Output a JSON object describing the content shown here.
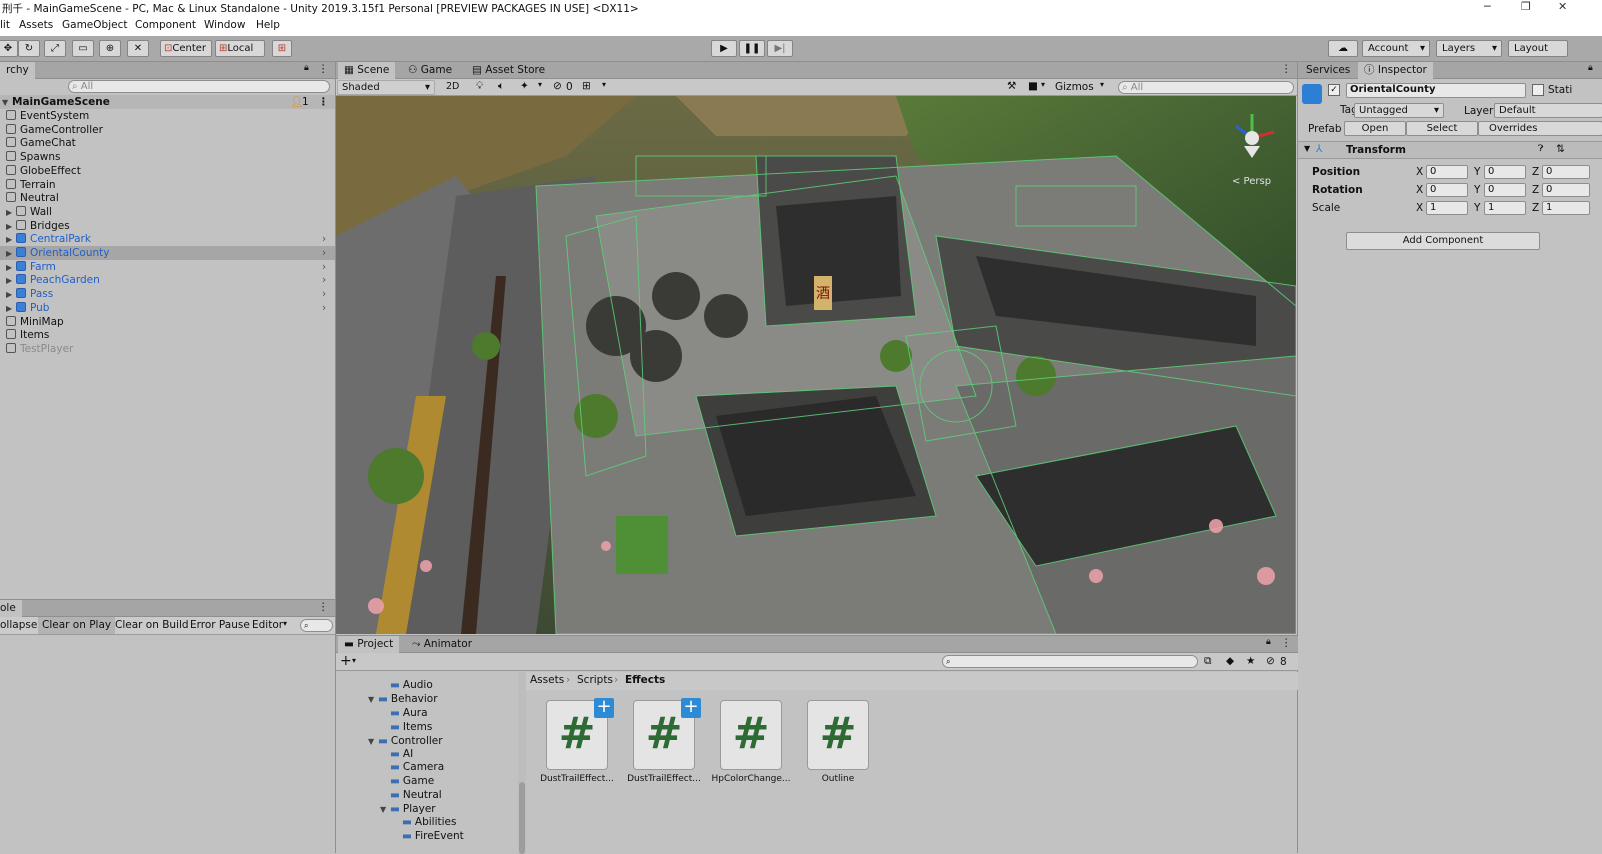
{
  "window": {
    "title": "刑千 - MainGameScene - PC, Mac & Linux Standalone - Unity 2019.3.15f1 Personal [PREVIEW PACKAGES IN USE] <DX11>",
    "minimize": "─",
    "restore": "❐",
    "close": "✕"
  },
  "menu": [
    "lit",
    "Assets",
    "GameObject",
    "Component",
    "Window",
    "Help"
  ],
  "toolbar": {
    "center": "Center",
    "local": "Local",
    "account": "Account",
    "layers": "Layers",
    "layout": "Layout"
  },
  "hierarchy": {
    "tab": "rchy",
    "search_placeholder": "All",
    "scene": "MainGameScene",
    "badge": "1",
    "items": [
      {
        "label": "EventSystem",
        "prefab": false
      },
      {
        "label": "GameController",
        "prefab": false
      },
      {
        "label": "GameChat",
        "prefab": false
      },
      {
        "label": "Spawns",
        "prefab": false
      },
      {
        "label": "GlobeEffect",
        "prefab": false
      },
      {
        "label": "Terrain",
        "prefab": false
      },
      {
        "label": "Neutral",
        "prefab": false
      },
      {
        "label": "Wall",
        "prefab": false
      },
      {
        "label": "Bridges",
        "prefab": false
      },
      {
        "label": "CentralPark",
        "prefab": true
      },
      {
        "label": "OrientalCounty",
        "prefab": true
      },
      {
        "label": "Farm",
        "prefab": true
      },
      {
        "label": "PeachGarden",
        "prefab": true
      },
      {
        "label": "Pass",
        "prefab": true
      },
      {
        "label": "Pub",
        "prefab": true
      },
      {
        "label": "MiniMap",
        "prefab": false
      },
      {
        "label": "Items",
        "prefab": false
      },
      {
        "label": "TestPlayer",
        "prefab": false
      }
    ]
  },
  "console": {
    "tab": "ole",
    "buttons": [
      "ollapse",
      "Clear on Play",
      "Clear on Build",
      "Error Pause",
      "Editor"
    ]
  },
  "scene_view": {
    "tabs": [
      "Scene",
      "Game",
      "Asset Store"
    ],
    "shading": "Shaded",
    "mode_2d": "2D",
    "hidden_count": "0",
    "gizmos": "Gizmos",
    "search_placeholder": "All",
    "persp": "< Persp",
    "sign": "酒"
  },
  "inspector": {
    "tabs": [
      "Services",
      "Inspector"
    ],
    "object_name": "OrientalCounty",
    "static": "Stati",
    "tag_label": "Tag",
    "tag_value": "Untagged",
    "layer_label": "Layer",
    "layer_value": "Default",
    "prefab_label": "Prefab",
    "prefab_open": "Open",
    "prefab_select": "Select",
    "prefab_overrides": "Overrides",
    "component": "Transform",
    "position_label": "Position",
    "rotation_label": "Rotation",
    "scale_label": "Scale",
    "position": [
      "0",
      "0",
      "0"
    ],
    "rotation": [
      "0",
      "0",
      "0"
    ],
    "scale": [
      "1",
      "1",
      "1"
    ],
    "axes": [
      "X",
      "Y",
      "Z"
    ],
    "add_component": "Add Component"
  },
  "project": {
    "tabs": [
      "Project",
      "Animator"
    ],
    "hidden_count": "8",
    "folders": [
      {
        "label": "Audio",
        "depth": 2
      },
      {
        "label": "Behavior",
        "depth": 1
      },
      {
        "label": "Aura",
        "depth": 2
      },
      {
        "label": "Items",
        "depth": 2
      },
      {
        "label": "Controller",
        "depth": 1
      },
      {
        "label": "AI",
        "depth": 2
      },
      {
        "label": "Camera",
        "depth": 2
      },
      {
        "label": "Game",
        "depth": 2
      },
      {
        "label": "Neutral",
        "depth": 2
      },
      {
        "label": "Player",
        "depth": 2
      },
      {
        "label": "Abilities",
        "depth": 3
      },
      {
        "label": "FireEvent",
        "depth": 3
      }
    ],
    "breadcrumb": [
      "Assets",
      "Scripts",
      "Effects"
    ],
    "files": [
      "DustTrailEffect...",
      "DustTrailEffect...",
      "HpColorChange...",
      "Outline"
    ]
  },
  "colors": {
    "prefab_blue": "#1f5fc7",
    "selection": "#a6a6a6",
    "script_green": "#2e6b34",
    "badge_orange": "#e08a1e"
  }
}
